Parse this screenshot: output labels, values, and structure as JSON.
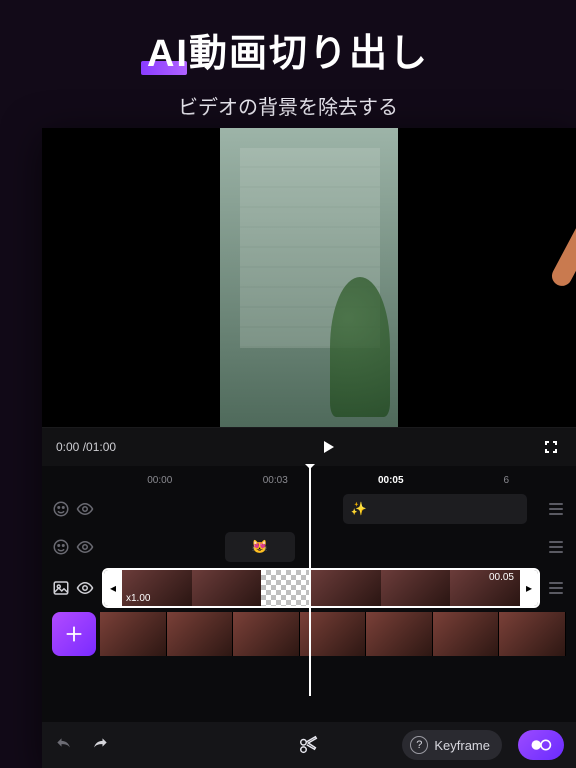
{
  "hero": {
    "title": "AI動画切り出し",
    "subtitle": "ビデオの背景を除去する"
  },
  "transport": {
    "current": "0:00",
    "total": "01:00"
  },
  "ruler": {
    "ticks": [
      "00:00",
      "00:03",
      "00:05",
      "6"
    ],
    "active_index": 2
  },
  "tracks": {
    "sparkle_emoji": "✨",
    "hearteyes_emoji": "😻"
  },
  "video_clip": {
    "speed": "x1.00",
    "end_time": "00.05"
  },
  "bottom": {
    "keyframe_label": "Keyframe"
  },
  "icons": {
    "play": "play-icon",
    "fullscreen": "fullscreen-icon",
    "emoji": "emoji-icon",
    "eye": "eye-icon",
    "image": "image-icon",
    "drag": "drag-handle-icon",
    "add": "plus-icon",
    "undo": "undo-icon",
    "redo": "redo-icon",
    "cut": "scissors-icon",
    "mask": "mask-icon",
    "help": "help-icon"
  }
}
